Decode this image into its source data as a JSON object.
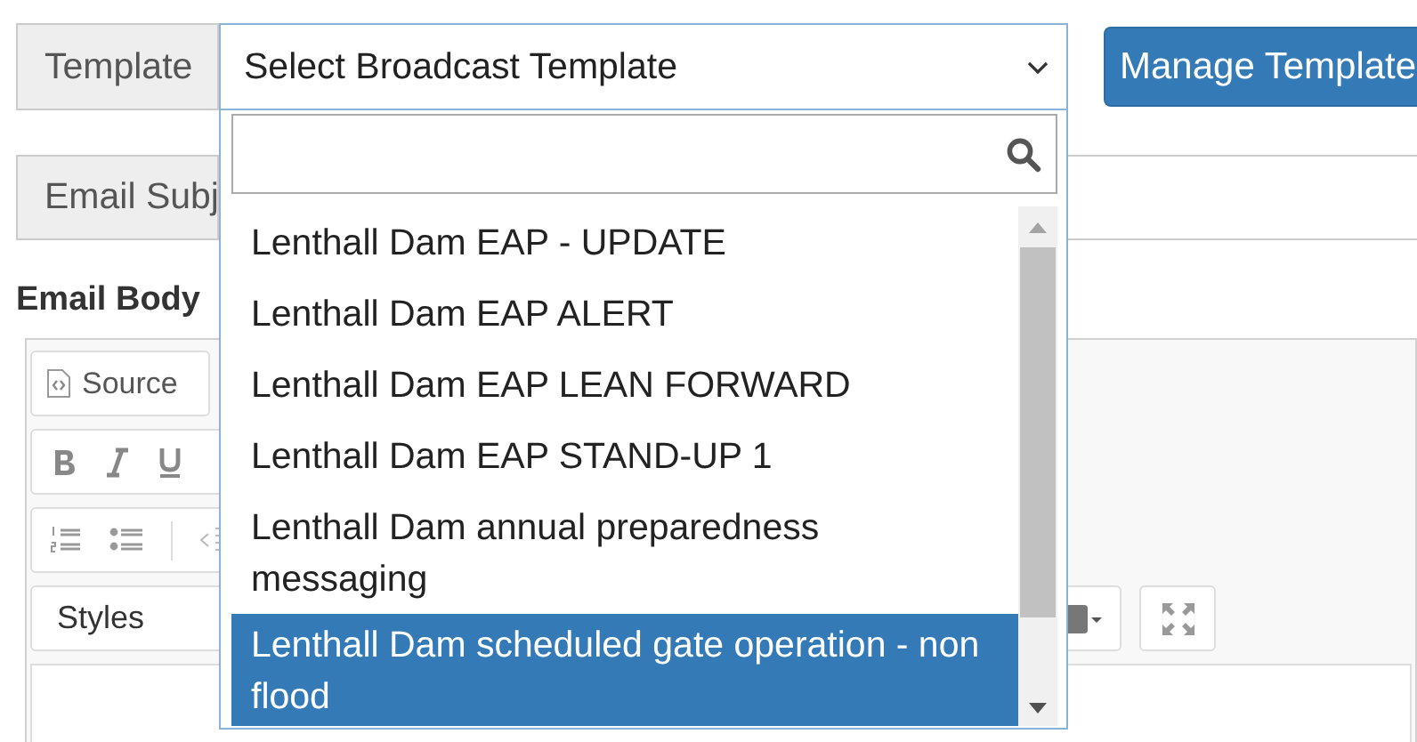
{
  "template": {
    "label": "Template",
    "select": {
      "value": "Select Broadcast Template",
      "expanded": true
    },
    "manage_button": "Manage Template"
  },
  "email_subject": {
    "label": "Email Subj"
  },
  "email_body": {
    "label": "Email Body",
    "source_button": "Source",
    "styles_combo": "Styles"
  },
  "options": [
    {
      "label": "Lenthall Dam EAP - UPDATE",
      "selected": false
    },
    {
      "label": "Lenthall Dam EAP ALERT",
      "selected": false
    },
    {
      "label": "Lenthall Dam EAP LEAN FORWARD",
      "selected": false
    },
    {
      "label": "Lenthall Dam EAP STAND-UP 1",
      "selected": false
    },
    {
      "label": "Lenthall Dam annual preparedness messaging",
      "selected": false
    },
    {
      "label": "Lenthall Dam scheduled gate operation - non flood",
      "selected": true
    }
  ]
}
